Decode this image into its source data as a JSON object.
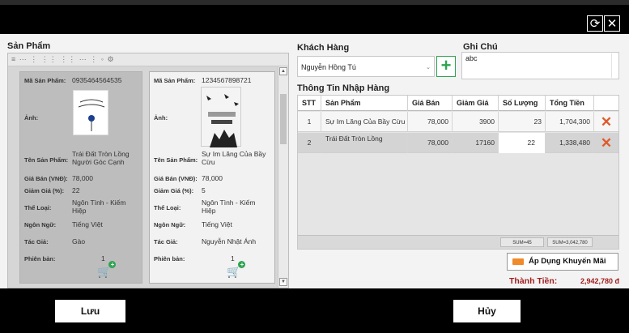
{
  "window": {
    "refresh_icon": "refresh-icon",
    "close_icon": "close-icon"
  },
  "products": {
    "title": "Sản Phẩm",
    "toolbar_text": "≡ ⋯ ⋮ ⋮⋮ ⋮⋮ ⋯ ⋮ ◦ ⚙",
    "labels": {
      "code": "Mã Sản Phẩm:",
      "image": "Ảnh:",
      "name": "Tên Sản Phẩm:",
      "price": "Giá Bán (VNĐ):",
      "discount": "Giảm Giá (%):",
      "category": "Thể Loại:",
      "language": "Ngôn Ngữ:",
      "author": "Tác Giả:",
      "edition": "Phiên bản:"
    },
    "items": [
      {
        "code": "0935464564535",
        "name": "Trái Đất Tròn Lồng Người Góc Cạnh",
        "price": "78,000",
        "discount": "22",
        "category": "Ngôn Tình - Kiếm Hiệp",
        "language": "Tiếng Việt",
        "author": "Gào",
        "edition": "1"
      },
      {
        "code": "1234567898721",
        "name": "Sự Im Lăng Của Bầy Cừu",
        "price": "78,000",
        "discount": "5",
        "category": "Ngôn Tình - Kiếm Hiệp",
        "language": "Tiếng Việt",
        "author": "Nguyễn Nhật Ánh",
        "edition": "1"
      }
    ]
  },
  "customer": {
    "label": "Khách Hàng",
    "value": "Nguyễn Hồng Tú",
    "add_label": "+"
  },
  "note": {
    "label": "Ghi Chú",
    "value": "abc"
  },
  "import_info": {
    "title": "Thông Tin Nhập Hàng",
    "columns": [
      "STT",
      "Sản Phẩm",
      "Giá Bán",
      "Giảm Giá",
      "Số Lượng",
      "Tổng Tiền"
    ],
    "rows": [
      {
        "stt": "1",
        "product": "Sự Im Lăng Của Bầy Cừu",
        "price": "78,000",
        "discount": "3900",
        "qty": "23",
        "total": "1,704,300"
      },
      {
        "stt": "2",
        "product": "Trái Đất Tròn Lồng",
        "price": "78,000",
        "discount": "17160",
        "qty": "22",
        "total": "1,338,480"
      }
    ],
    "delete_icon": "✕",
    "sum_qty": "SUM=45",
    "sum_total": "SUM=3,042,780"
  },
  "promo_button": "Áp Dụng Khuyến Mãi",
  "total": {
    "label": "Thành Tiền:",
    "value": "2,942,780 đ"
  },
  "buttons": {
    "save": "Lưu",
    "cancel": "Hủy"
  }
}
